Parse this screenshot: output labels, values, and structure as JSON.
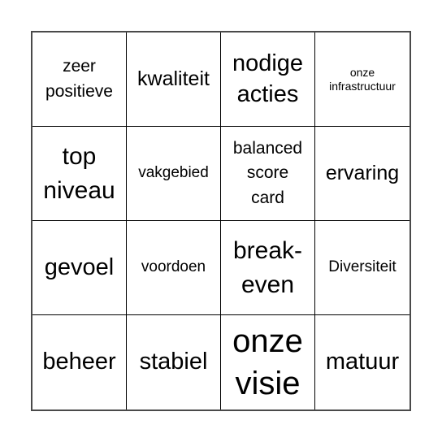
{
  "bingo": {
    "cells": [
      [
        "zeer\npositieve",
        "kwaliteit",
        "nodige\nacties",
        "onze\ninfrastructuur"
      ],
      [
        "top\nniveau",
        "vakgebied",
        "balanced\nscore\ncard",
        "ervaring"
      ],
      [
        "gevoel",
        "voordoen",
        "break-\neven",
        "Diversiteit"
      ],
      [
        "beheer",
        "stabiel",
        "onze\nvisie",
        "matuur"
      ]
    ],
    "rows": [
      [
        "zeer positieve",
        "kwaliteit",
        "nodige acties",
        "onze infrastructuur"
      ],
      [
        "top niveau",
        "vakgebied",
        "balanced score card",
        "ervaring"
      ],
      [
        "gevoel",
        "voordoen",
        "break-even",
        "Diversiteit"
      ],
      [
        "beheer",
        "stabiel",
        "onze visie",
        "matuur"
      ]
    ],
    "lines": {
      "r0c0": [
        "zeer",
        "positieve"
      ],
      "r0c1": [
        "kwaliteit"
      ],
      "r0c2": [
        "nodige",
        "acties"
      ],
      "r0c3": [
        "onze",
        "infrastructuur"
      ],
      "r1c0": [
        "top",
        "niveau"
      ],
      "r1c1": [
        "vakgebied"
      ],
      "r1c2": [
        "balanced",
        "score",
        "card"
      ],
      "r1c3": [
        "ervaring"
      ],
      "r2c0": [
        "gevoel"
      ],
      "r2c1": [
        "voordoen"
      ],
      "r2c2": [
        "break-",
        "even"
      ],
      "r2c3": [
        "Diversiteit"
      ],
      "r3c0": [
        "beheer"
      ],
      "r3c1": [
        "stabiel"
      ],
      "r3c2": [
        "onze",
        "visie"
      ],
      "r3c3": [
        "matuur"
      ]
    }
  }
}
